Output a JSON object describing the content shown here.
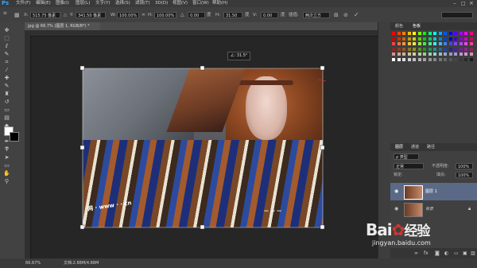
{
  "app": {
    "logo": "Ps"
  },
  "menu": [
    "文件(F)",
    "编辑(E)",
    "图像(I)",
    "图层(L)",
    "文字(Y)",
    "选择(S)",
    "滤镜(T)",
    "3D(D)",
    "视图(V)",
    "窗口(W)",
    "帮助(H)"
  ],
  "options": {
    "x_label": "X:",
    "x_value": "515.75 像素",
    "y_label": "Y:",
    "y_value": "341.50 像素",
    "w_label": "W:",
    "w_value": "100.00%",
    "h_label": "H:",
    "h_value": "100.00%",
    "angle_value": "0.00",
    "angle_unit": "度",
    "hskew_label": "H:",
    "hskew_value": "31.50",
    "hskew_unit": "度",
    "vskew_label": "V:",
    "vskew_value": "0.00",
    "vskew_unit": "度",
    "interp_label": "插值:",
    "interp_value": "两次立方"
  },
  "doc_tab": {
    "label": "jpg @ 66.7% (图层 1, RGB/8*) *"
  },
  "transform_tooltip": "∠: 31.5°",
  "status": {
    "zoom": "66.67%",
    "doc": "文档:2.88M/4.88M"
  },
  "panels": {
    "swatch_tab": "颜色",
    "swatch_tab2": "色板"
  },
  "layers": {
    "tabs": [
      "图层",
      "通道",
      "路径"
    ],
    "filter": "ρ 类型",
    "blend": "正常",
    "opacity_label": "不透明度:",
    "opacity_value": "100%",
    "lock_label": "锁定:",
    "fill_label": "填充:",
    "fill_value": "100%",
    "items": [
      {
        "name": "图层 1"
      },
      {
        "name": "背景"
      }
    ]
  },
  "watermark": {
    "text": "jingyan.baidu.com",
    "brand": "Bai",
    "brand2": "经验"
  },
  "colors": {
    "accent": "#31a8ff",
    "selected_layer": "#5a6a86"
  }
}
